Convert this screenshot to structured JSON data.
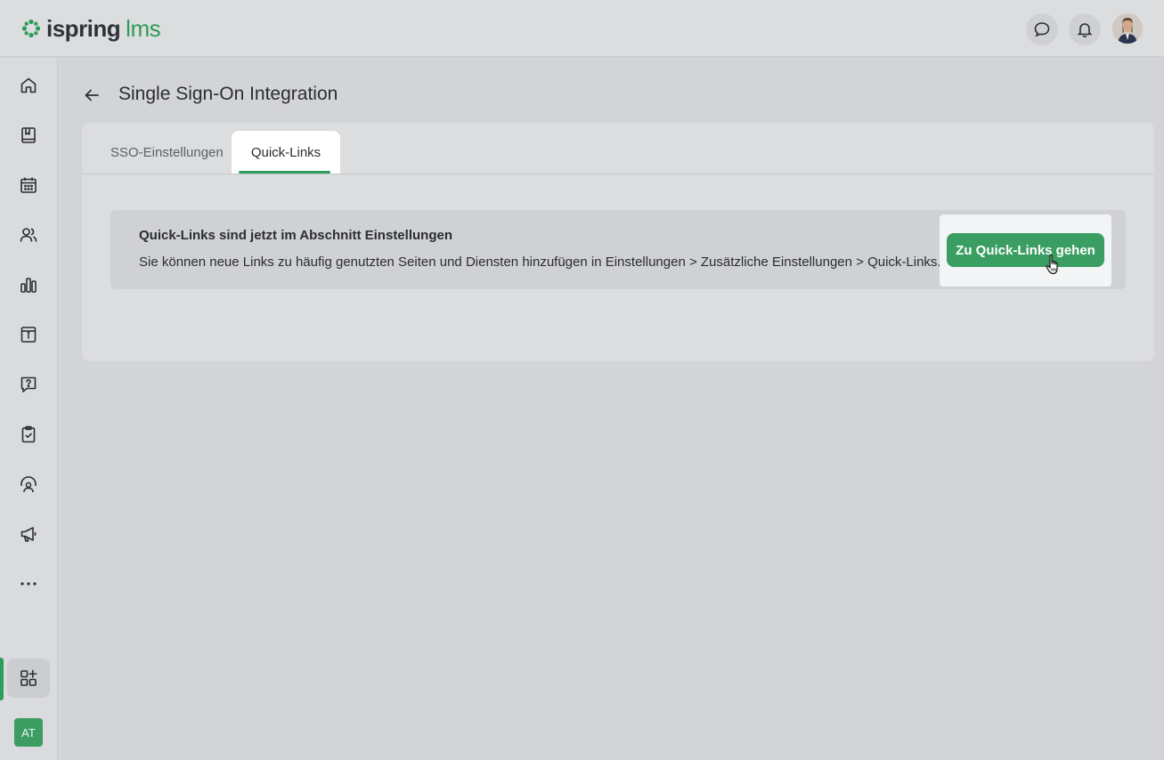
{
  "header": {
    "logo_primary": "ispring",
    "logo_secondary": "lms",
    "chat_icon": "chat-bubble-icon",
    "bell_icon": "bell-icon",
    "brand_color": "#2e9c5a"
  },
  "sidebar": {
    "items": [
      {
        "icon": "home-icon"
      },
      {
        "icon": "book-icon"
      },
      {
        "icon": "calendar-icon"
      },
      {
        "icon": "users-icon"
      },
      {
        "icon": "bar-chart-icon"
      },
      {
        "icon": "info-board-icon"
      },
      {
        "icon": "question-chat-icon"
      },
      {
        "icon": "clipboard-check-icon"
      },
      {
        "icon": "mentor-icon"
      },
      {
        "icon": "megaphone-icon"
      },
      {
        "icon": "more-dots-icon"
      },
      {
        "icon": "apps-add-icon"
      }
    ],
    "user_initials": "AT"
  },
  "page": {
    "title": "Single Sign-On Integration",
    "tabs": [
      {
        "label": "SSO-Einstellungen",
        "selected": false
      },
      {
        "label": "Quick-Links",
        "selected": true
      }
    ],
    "notice": {
      "title": "Quick-Links sind jetzt im Abschnitt Einstellungen",
      "text": "Sie können neue Links zu häufig genutzten Seiten und Diensten hinzufügen in Einstellungen > Zusätzliche Einstellungen > Quick-Links.",
      "button_label": "Zu Quick-Links gehen"
    }
  }
}
